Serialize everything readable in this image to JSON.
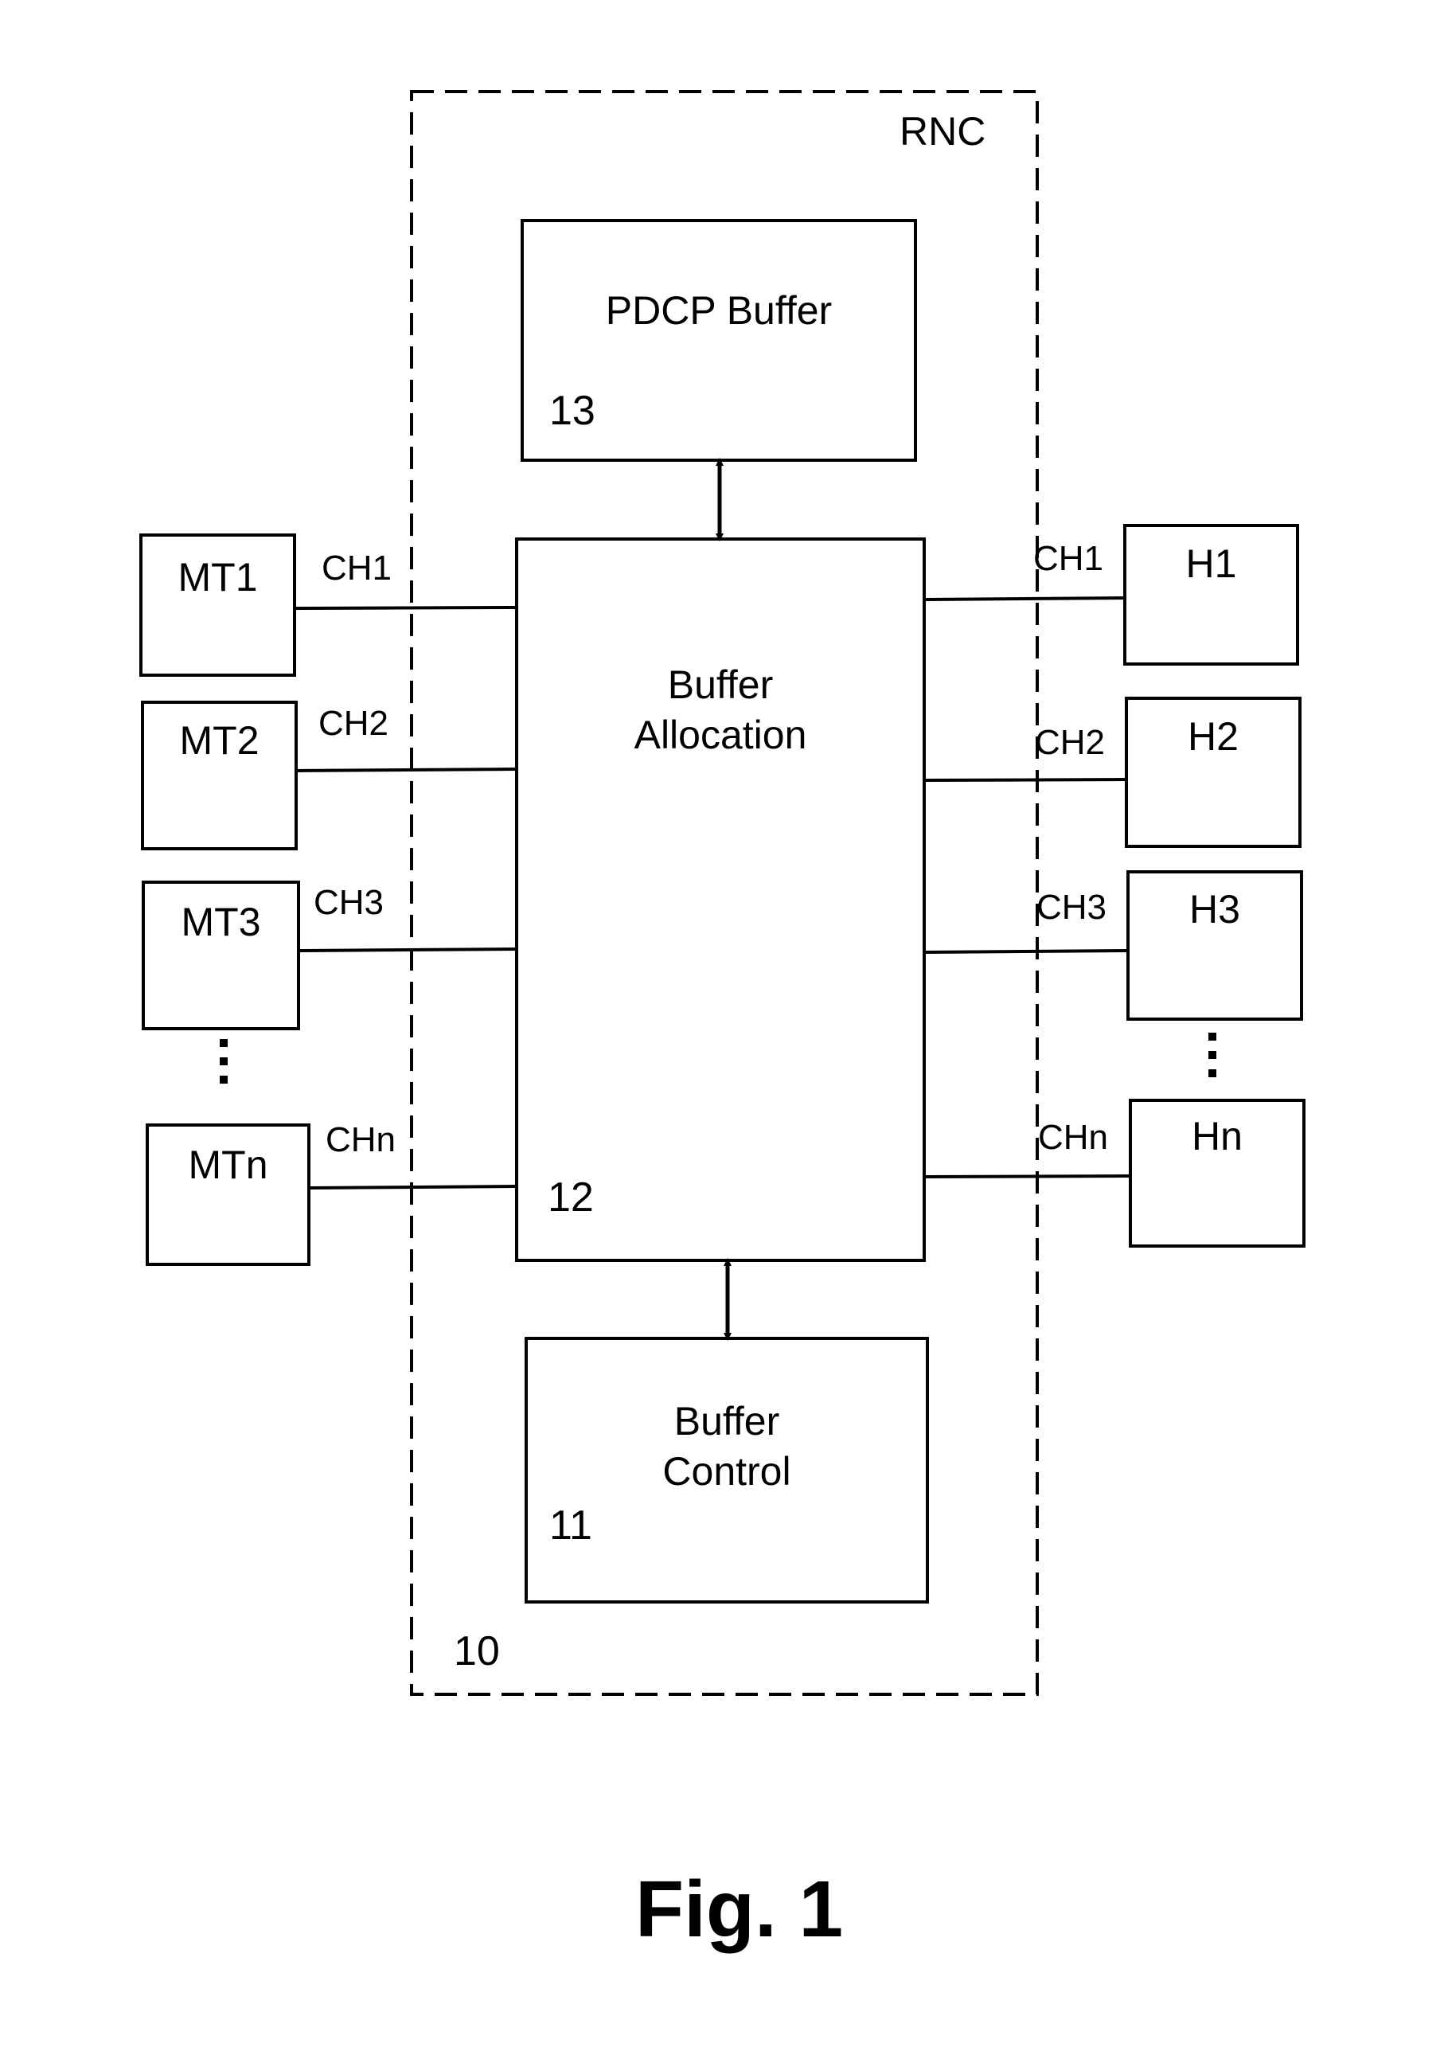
{
  "container": {
    "label": "RNC",
    "ref": "10"
  },
  "pdcp_buffer": {
    "label": "PDCP Buffer",
    "ref": "13"
  },
  "buffer_allocation": {
    "label_line1": "Buffer",
    "label_line2": "Allocation",
    "ref": "12"
  },
  "buffer_control": {
    "label_line1": "Buffer",
    "label_line2": "Control",
    "ref": "11"
  },
  "mobile_terminals": [
    {
      "label": "MT1",
      "channel": "CH1"
    },
    {
      "label": "MT2",
      "channel": "CH2"
    },
    {
      "label": "MT3",
      "channel": "CH3"
    },
    {
      "label": "MTn",
      "channel": "CHn"
    }
  ],
  "hosts": [
    {
      "label": "H1",
      "channel": "CH1"
    },
    {
      "label": "H2",
      "channel": "CH2"
    },
    {
      "label": "H3",
      "channel": "CH3"
    },
    {
      "label": "Hn",
      "channel": "CHn"
    }
  ],
  "ellipsis": "⋮",
  "caption": "Fig. 1"
}
